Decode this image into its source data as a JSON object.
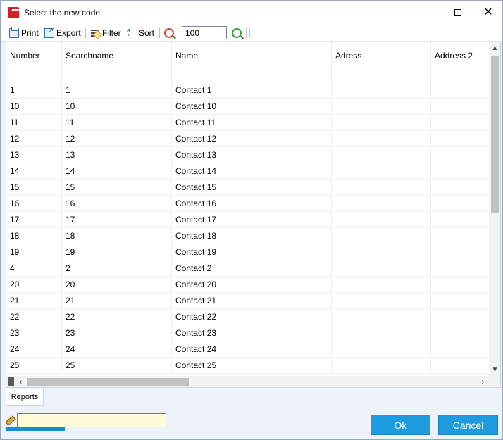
{
  "window": {
    "title": "Select the new code"
  },
  "toolbar": {
    "print_label": "Print",
    "export_label": "Export",
    "filter_label": "Filter",
    "sort_label": "Sort",
    "zoom_value": "100"
  },
  "grid": {
    "columns": [
      "Number",
      "Searchname",
      "Name",
      "Adress",
      "Address 2"
    ],
    "rows": [
      [
        "1",
        "1",
        "Contact 1",
        "",
        ""
      ],
      [
        "10",
        "10",
        "Contact 10",
        "",
        ""
      ],
      [
        "11",
        "11",
        "Contact 11",
        "",
        ""
      ],
      [
        "12",
        "12",
        "Contact 12",
        "",
        ""
      ],
      [
        "13",
        "13",
        "Contact 13",
        "",
        ""
      ],
      [
        "14",
        "14",
        "Contact 14",
        "",
        ""
      ],
      [
        "15",
        "15",
        "Contact 15",
        "",
        ""
      ],
      [
        "16",
        "16",
        "Contact 16",
        "",
        ""
      ],
      [
        "17",
        "17",
        "Contact 17",
        "",
        ""
      ],
      [
        "18",
        "18",
        "Contact 18",
        "",
        ""
      ],
      [
        "19",
        "19",
        "Contact 19",
        "",
        ""
      ],
      [
        "4",
        "2",
        "Contact 2",
        "",
        ""
      ],
      [
        "20",
        "20",
        "Contact 20",
        "",
        ""
      ],
      [
        "21",
        "21",
        "Contact 21",
        "",
        ""
      ],
      [
        "22",
        "22",
        "Contact 22",
        "",
        ""
      ],
      [
        "23",
        "23",
        "Contact 23",
        "",
        ""
      ],
      [
        "24",
        "24",
        "Contact 24",
        "",
        ""
      ],
      [
        "25",
        "25",
        "Contact 25",
        "",
        ""
      ]
    ]
  },
  "tabs": {
    "reports_label": "Reports"
  },
  "status": {
    "input_value": ""
  },
  "buttons": {
    "ok_label": "Ok",
    "cancel_label": "Cancel"
  },
  "colors": {
    "accent": "#1f9be0",
    "status_field_bg": "#fffbd6"
  }
}
